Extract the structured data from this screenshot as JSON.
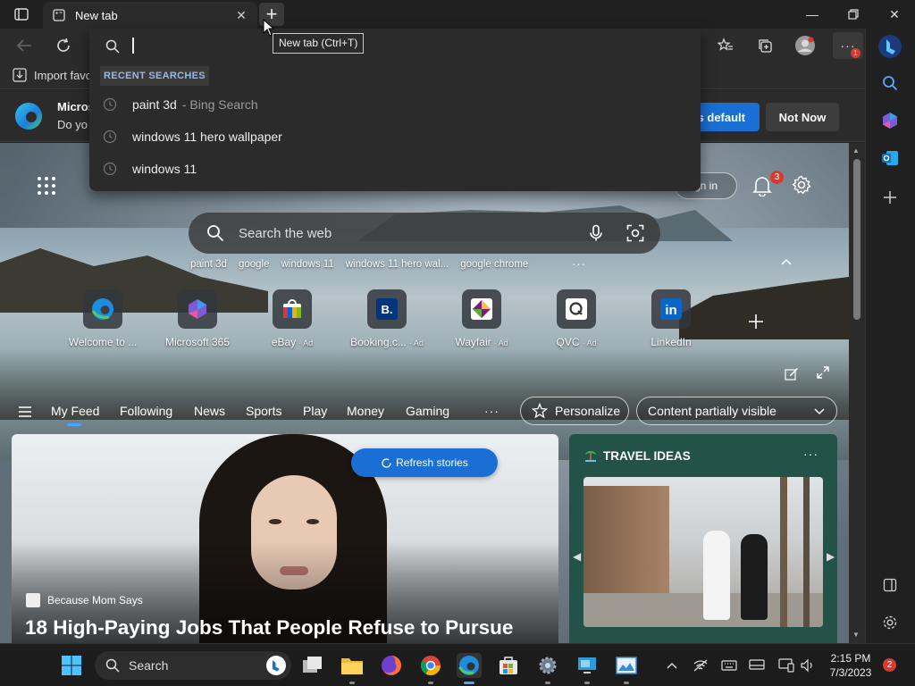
{
  "window": {
    "tab_title": "New tab",
    "newtab_tooltip": "New tab (Ctrl+T)"
  },
  "address_dropdown": {
    "section_label": "RECENT SEARCHES",
    "items": [
      {
        "text": "paint 3d",
        "sub": "- Bing Search"
      },
      {
        "text": "windows 11 hero wallpaper",
        "sub": ""
      },
      {
        "text": "windows 11",
        "sub": ""
      }
    ]
  },
  "favorites_bar": {
    "import_label": "Import favo"
  },
  "promo": {
    "title": "Micros",
    "text": "Do yo",
    "default_button": "s default",
    "not_now_button": "Not Now",
    "accent_color": "#1a6fd4"
  },
  "ntp": {
    "signin_label": "gn in",
    "notification_count": "3",
    "search_placeholder": "Search the web",
    "quick_searches": [
      "paint 3d",
      "google",
      "windows 11",
      "windows 11 hero wal...",
      "google chrome"
    ],
    "quick_more": "···",
    "tiles": [
      {
        "label": "Welcome to ...",
        "ad": "",
        "icon": "edge-icon"
      },
      {
        "label": "Microsoft 365",
        "ad": "",
        "icon": "m365-icon"
      },
      {
        "label": "eBay",
        "ad": "· Ad",
        "icon": "ebay-icon"
      },
      {
        "label": "Booking.c...",
        "ad": "· Ad",
        "icon": "booking-icon"
      },
      {
        "label": "Wayfair",
        "ad": "· Ad",
        "icon": "wayfair-icon"
      },
      {
        "label": "QVC",
        "ad": "· Ad",
        "icon": "qvc-icon"
      },
      {
        "label": "LinkedIn",
        "ad": "",
        "icon": "linkedin-icon"
      }
    ]
  },
  "feed": {
    "nav": [
      "My Feed",
      "Following",
      "News",
      "Sports",
      "Play",
      "Money",
      "Gaming"
    ],
    "more": "···",
    "personalize": "Personalize",
    "content_visibility": "Content partially visible",
    "refresh": "Refresh stories",
    "hero": {
      "source": "Because Mom Says",
      "headline": "18 High-Paying Jobs That People Refuse to Pursue"
    },
    "travel": {
      "title": "TRAVEL IDEAS",
      "more": "···"
    }
  },
  "taskbar": {
    "search_label": "Search",
    "time": "2:15 PM",
    "date": "7/3/2023",
    "notification_count": "2"
  }
}
